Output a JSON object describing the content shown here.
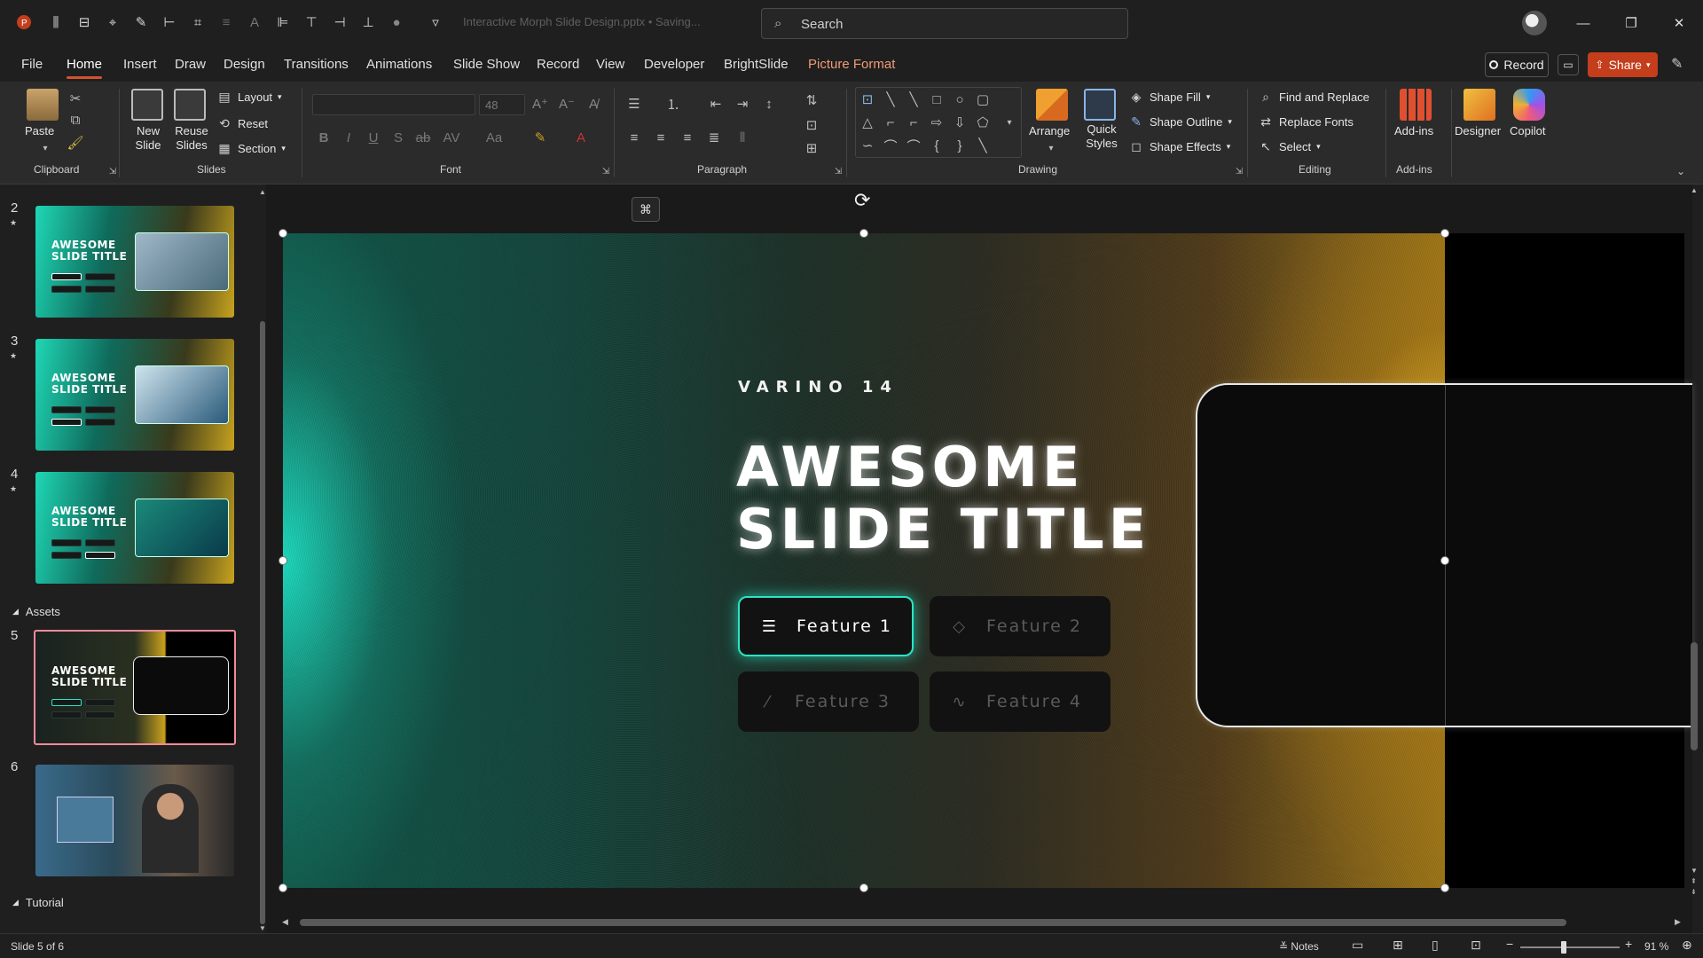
{
  "app": {
    "doc_title": "Interactive Morph Slide Design.pptx • Saving...",
    "search_placeholder": "Search"
  },
  "menu": {
    "tabs": [
      "File",
      "Home",
      "Insert",
      "Draw",
      "Design",
      "Transitions",
      "Animations",
      "Slide Show",
      "Record",
      "View",
      "Developer",
      "BrightSlide",
      "Picture Format"
    ],
    "record_label": "Record",
    "share_label": "Share"
  },
  "ribbon": {
    "clipboard": {
      "paste": "Paste",
      "label": "Clipboard"
    },
    "slides": {
      "new_slide": "New Slide",
      "reuse_slides": "Reuse Slides",
      "layout": "Layout",
      "reset": "Reset",
      "section": "Section",
      "label": "Slides"
    },
    "font": {
      "font_size": "48",
      "label": "Font"
    },
    "paragraph": {
      "label": "Paragraph"
    },
    "drawing": {
      "arrange": "Arrange",
      "quick_styles": "Quick Styles",
      "shape_fill": "Shape Fill",
      "shape_outline": "Shape Outline",
      "shape_effects": "Shape Effects",
      "label": "Drawing"
    },
    "editing": {
      "find_replace": "Find and Replace",
      "replace_fonts": "Replace Fonts",
      "select": "Select",
      "label": "Editing"
    },
    "addins": {
      "addins": "Add-ins",
      "label": "Add-ins"
    },
    "designer": "Designer",
    "copilot": "Copilot"
  },
  "thumbnails": {
    "slides": [
      {
        "num": "2",
        "title": "AWESOME SLIDE TITLE"
      },
      {
        "num": "3",
        "title": "AWESOME SLIDE TITLE"
      },
      {
        "num": "4",
        "title": "AWESOME SLIDE TITLE"
      },
      {
        "num": "5",
        "title": "AWESOME SLIDE TITLE"
      },
      {
        "num": "6",
        "title": ""
      }
    ],
    "sections": {
      "assets": "Assets",
      "tutorial": "Tutorial"
    }
  },
  "slide": {
    "subtitle": "VARINO 14",
    "title_line1": "AWESOME",
    "title_line2": "SLIDE TITLE",
    "features": [
      "Feature 1",
      "Feature 2",
      "Feature 3",
      "Feature 4"
    ],
    "accent_color": "#29e5c5"
  },
  "status": {
    "slide_info": "Slide 5 of 6",
    "notes": "Notes",
    "zoom": "91 %"
  }
}
